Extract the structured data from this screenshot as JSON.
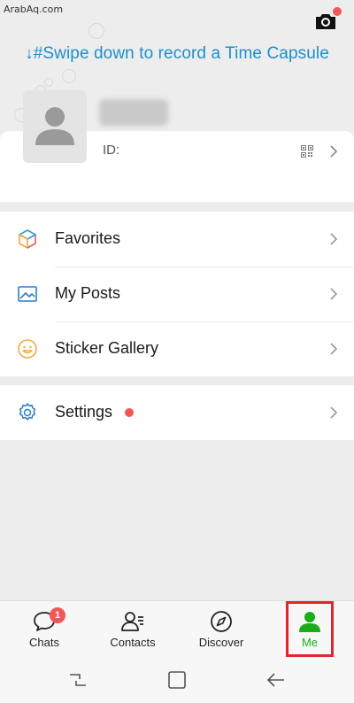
{
  "watermark": "ArabAq.com",
  "header": {
    "swipe_hint": "↓#Swipe down to record a Time Capsule",
    "camera_icon": "camera-icon"
  },
  "profile": {
    "id_label": "ID:",
    "avatar_icon": "person-silhouette-icon",
    "qr_icon": "qr-code-icon"
  },
  "menu_sections": [
    {
      "items": [
        {
          "label": "Favorites",
          "icon": "cube-icon"
        },
        {
          "label": "My Posts",
          "icon": "image-icon"
        },
        {
          "label": "Sticker Gallery",
          "icon": "smiley-icon"
        }
      ]
    },
    {
      "items": [
        {
          "label": "Settings",
          "icon": "gear-icon",
          "has_red_dot": true
        }
      ]
    }
  ],
  "tabbar": {
    "tabs": [
      {
        "label": "Chats",
        "icon": "chat-bubble-icon",
        "badge": "1"
      },
      {
        "label": "Contacts",
        "icon": "contacts-icon"
      },
      {
        "label": "Discover",
        "icon": "compass-icon"
      },
      {
        "label": "Me",
        "icon": "person-icon",
        "active": true
      }
    ]
  },
  "colors": {
    "accent_green": "#1aad19",
    "link_blue": "#1c8fcb",
    "badge_red": "#f25757",
    "highlight_red": "#e3262b"
  }
}
